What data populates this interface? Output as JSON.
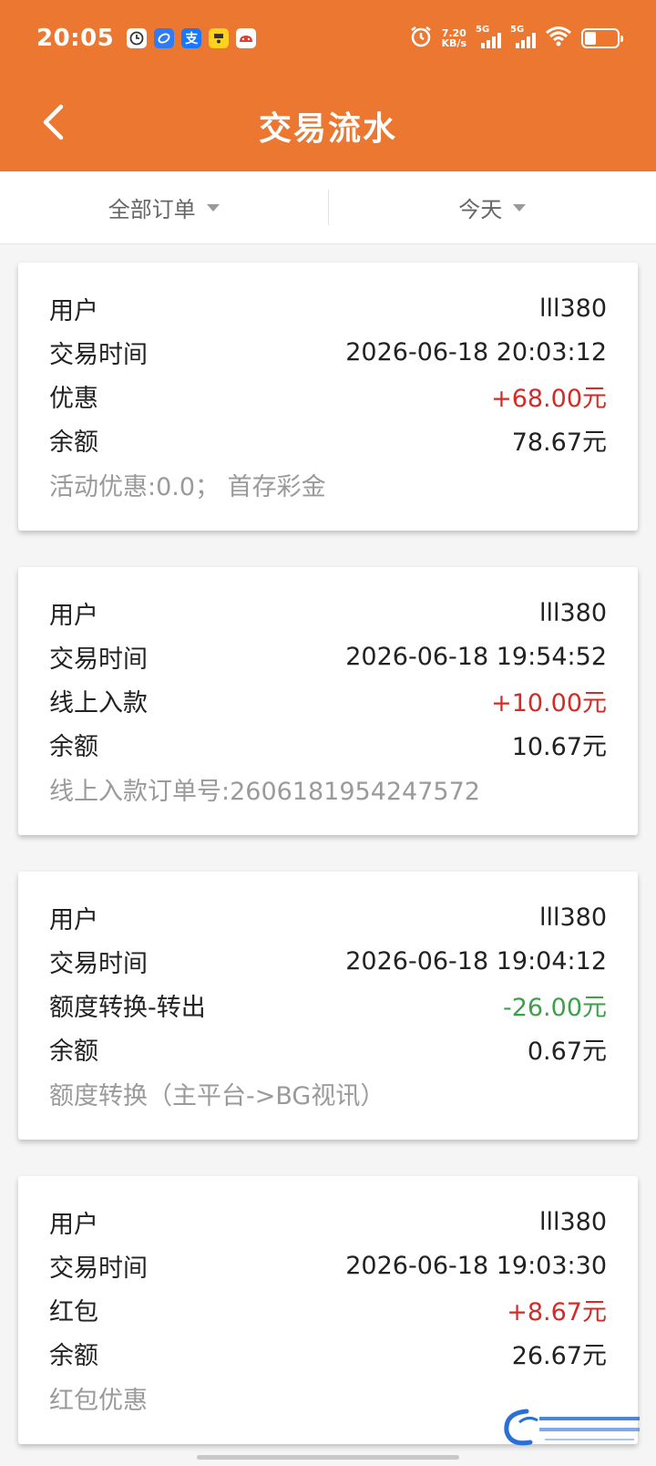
{
  "status": {
    "time": "20:05",
    "speed_value": "7.20",
    "speed_unit": "KB/s",
    "sig1": "5G",
    "sig2": "5G",
    "app_icons": [
      "clock-app-icon",
      "browser-app-icon",
      "alipay-app-icon",
      "taobao-app-icon",
      "game-app-icon"
    ],
    "alipay_glyph": "支",
    "battery_level": 0.35
  },
  "header": {
    "title": "交易流水"
  },
  "filters": {
    "type": "全部订单",
    "date": "今天"
  },
  "records": [
    {
      "user_label": "用户",
      "user": "lll380",
      "time_label": "交易时间",
      "time": "2026-06-18 20:03:12",
      "type_label": "优惠",
      "amount": "+68.00元",
      "amount_sign": "pos",
      "balance_label": "余额",
      "balance": "78.67元",
      "note": "活动优惠:0.0；  首存彩金"
    },
    {
      "user_label": "用户",
      "user": "lll380",
      "time_label": "交易时间",
      "time": "2026-06-18 19:54:52",
      "type_label": "线上入款",
      "amount": "+10.00元",
      "amount_sign": "pos",
      "balance_label": "余额",
      "balance": "10.67元",
      "note": "线上入款订单号:2606181954247572"
    },
    {
      "user_label": "用户",
      "user": "lll380",
      "time_label": "交易时间",
      "time": "2026-06-18 19:04:12",
      "type_label": "额度转换-转出",
      "amount": "-26.00元",
      "amount_sign": "neg",
      "balance_label": "余额",
      "balance": "0.67元",
      "note": "额度转换（主平台->BG视讯）"
    },
    {
      "user_label": "用户",
      "user": "lll380",
      "time_label": "交易时间",
      "time": "2026-06-18 19:03:30",
      "type_label": "红包",
      "amount": "+8.67元",
      "amount_sign": "pos",
      "balance_label": "余额",
      "balance": "26.67元",
      "note": "红包优惠"
    }
  ],
  "colors": {
    "brand": "#ec7731",
    "positive": "#d42b26",
    "negative": "#3ea04a"
  }
}
